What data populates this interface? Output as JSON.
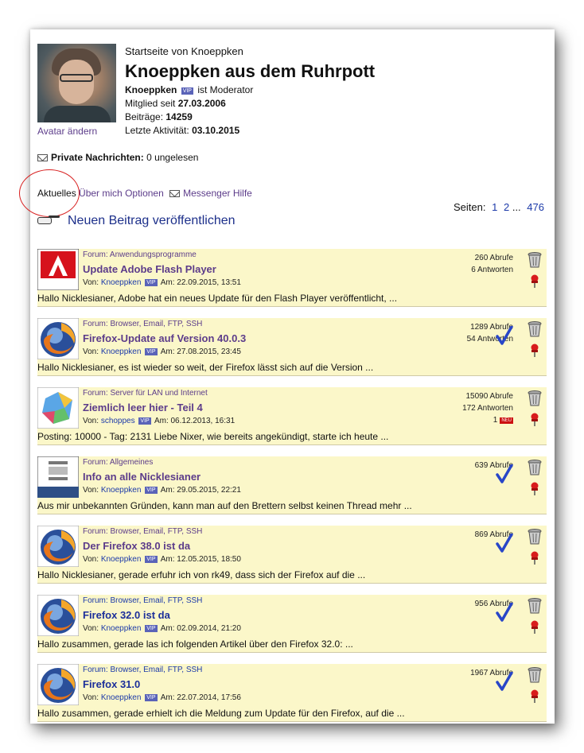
{
  "profile": {
    "subtitle": "Startseite von Knoeppken",
    "title": "Knoeppken aus dem Ruhrpott",
    "username": "Knoeppken",
    "vip": "VIP",
    "role": "ist Moderator",
    "member_since_label": "Mitglied seit",
    "member_since": "27.03.2006",
    "posts_label": "Beiträge:",
    "posts": "14259",
    "last_activity_label": "Letzte Aktivität:",
    "last_activity": "03.10.2015",
    "avatar_link": "Avatar ändern"
  },
  "messages": {
    "label": "Private Nachrichten:",
    "value": "0 ungelesen"
  },
  "tabs": {
    "active": "Aktuelles",
    "about": "Über mich",
    "options": "Optionen",
    "messenger": "Messenger",
    "help": "Hilfe"
  },
  "pagination": {
    "label": "Seiten:",
    "current": "1",
    "next": "2",
    "ellipsis": "...",
    "last": "476"
  },
  "new_post": "Neuen Beitrag veröffentlichen",
  "posts": [
    {
      "forum": "Forum: Anwendungsprogramme",
      "title": "Update Adobe Flash Player",
      "by": "Von:",
      "author": "Knoeppken",
      "date": "Am: 22.09.2015, 13:51",
      "views": "260 Abrufe",
      "answers": "6 Antworten",
      "new_count": "",
      "excerpt": "Hallo Nicklesianer, Adobe hat ein neues Update für den Flash Player veröffentlicht, ...",
      "thumb": "adobe",
      "thumb_text": "Adobe",
      "solved": false
    },
    {
      "forum": "Forum: Browser, Email, FTP, SSH",
      "title": "Firefox-Update auf Version 40.0.3",
      "by": "Von:",
      "author": "Knoeppken",
      "date": "Am: 27.08.2015, 23:45",
      "views": "1289 Abrufe",
      "answers": "54 Antworten",
      "new_count": "",
      "excerpt": "Hallo Nicklesianer, es ist wieder so weit, der Firefox lässt sich auf die Version ...",
      "thumb": "firefox",
      "thumb_text": "",
      "solved": true
    },
    {
      "forum": "Forum: Server für LAN und Internet",
      "title": "Ziemlich leer hier - Teil 4",
      "by": "Von:",
      "author": "schoppes",
      "date": "Am: 06.12.2013, 16:31",
      "views": "15090 Abrufe",
      "answers": "172 Antworten",
      "new_count": "1",
      "neu": "NEU",
      "excerpt": "Posting: 10000 - Tag: 2131 Liebe Nixer, wie bereits angekündigt, starte ich heute ...",
      "thumb": "puzzle",
      "thumb_text": "",
      "solved": false
    },
    {
      "forum": "Forum: Allgemeines",
      "title": "Info an alle Nicklesianer",
      "by": "Von:",
      "author": "Knoeppken",
      "date": "Am: 29.05.2015, 22:21",
      "views": "639 Abrufe",
      "answers": "",
      "new_count": "",
      "excerpt": "Aus mir unbekannten Gründen, kann man auf den Brettern selbst keinen Thread mehr ...",
      "thumb": "info",
      "thumb_text": "Information",
      "solved": true
    },
    {
      "forum": "Forum: Browser, Email, FTP, SSH",
      "title": "Der Firefox 38.0 ist da",
      "by": "Von:",
      "author": "Knoeppken",
      "date": "Am: 12.05.2015, 18:50",
      "views": "869 Abrufe",
      "answers": "",
      "new_count": "",
      "excerpt": "Hallo Nicklesianer, gerade erfuhr ich von rk49, dass sich der Firefox auf die ...",
      "thumb": "firefox",
      "thumb_text": "",
      "solved": true
    },
    {
      "forum": "Forum: Browser, Email, FTP, SSH",
      "title": "Firefox 32.0 ist da",
      "by": "Von:",
      "author": "Knoeppken",
      "date": "Am: 02.09.2014, 21:20",
      "views": "956 Abrufe",
      "answers": "",
      "new_count": "",
      "excerpt": "Hallo zusammen, gerade las ich folgenden Artikel über den Firefox 32.0: ...",
      "thumb": "firefox",
      "thumb_text": "",
      "solved": true,
      "link_blue": true
    },
    {
      "forum": "Forum: Browser, Email, FTP, SSH",
      "title": "Firefox 31.0",
      "by": "Von:",
      "author": "Knoeppken",
      "date": "Am: 22.07.2014, 17:56",
      "views": "1967 Abrufe",
      "answers": "",
      "new_count": "",
      "excerpt": "Hallo zusammen, gerade erhielt ich die Meldung zum Update für den Firefox, auf die ...",
      "thumb": "firefox",
      "thumb_text": "",
      "solved": true,
      "link_blue": true
    }
  ],
  "colors": {
    "post_bg": "#fbf7c9",
    "link": "#5c3c8a",
    "blue_link": "#1c2f9a",
    "annotation": "#d82020"
  }
}
